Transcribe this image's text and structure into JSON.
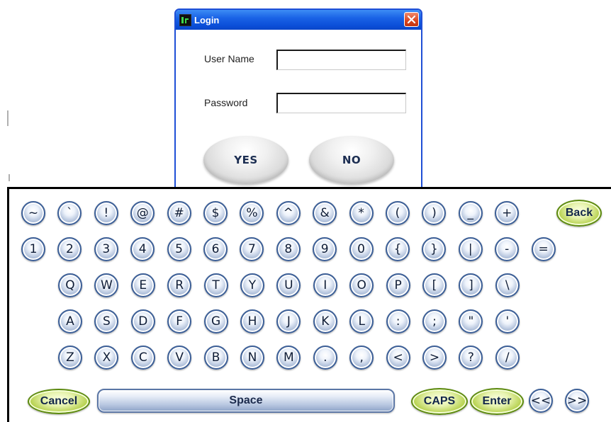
{
  "login": {
    "title": "Login",
    "user_name_label": "User Name",
    "user_name_value": "",
    "password_label": "Password",
    "password_value": "",
    "yes_label": "YES",
    "no_label": "NO"
  },
  "keyboard": {
    "rows": [
      [
        "~",
        "`",
        "!",
        "@",
        "#",
        "$",
        "%",
        "^",
        "&",
        "*",
        "(",
        ")",
        "_",
        "+",
        "Back"
      ],
      [
        "1",
        "2",
        "3",
        "4",
        "5",
        "6",
        "7",
        "8",
        "9",
        "0",
        "{",
        "}",
        "|",
        "-",
        "="
      ],
      [
        "Q",
        "W",
        "E",
        "R",
        "T",
        "Y",
        "U",
        "I",
        "O",
        "P",
        "[",
        "]",
        "\\"
      ],
      [
        "A",
        "S",
        "D",
        "F",
        "G",
        "H",
        "J",
        "K",
        "L",
        ":",
        ";",
        "\"",
        "'"
      ],
      [
        "Z",
        "X",
        "C",
        "V",
        "B",
        "N",
        "M",
        ".",
        ",",
        "<",
        ">",
        "?",
        "/"
      ]
    ],
    "bottom": {
      "cancel": "Cancel",
      "space": "Space",
      "caps": "CAPS",
      "enter": "Enter",
      "left": "<<",
      "right": ">>"
    }
  },
  "colors": {
    "title_bar": "#0b4ed8",
    "close_button": "#d9441d",
    "key_border": "#3c5f97",
    "green_key": "#b5d04c"
  }
}
